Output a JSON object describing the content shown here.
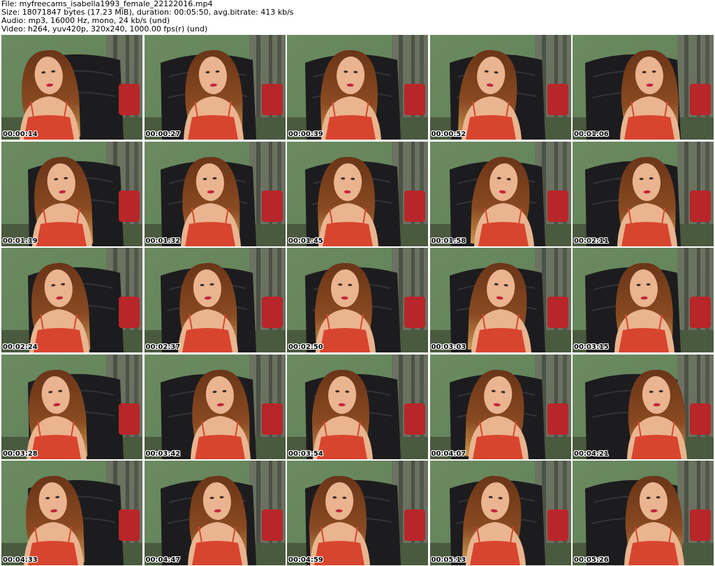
{
  "header": {
    "file_line": "File: myfreecams_isabella1993_female_22122016.mp4",
    "size_line": "Size: 18071847 bytes (17.23 MiB), duration: 00:05:50, avg.bitrate: 413 kb/s",
    "audio_line": "Audio: mp3, 16000 Hz, mono, 24 kb/s (und)",
    "video_line": "Video: h264, yuv420p, 320x240, 1000.00 fps(r) (und)"
  },
  "thumbnails": [
    {
      "timestamp": "00:00:14"
    },
    {
      "timestamp": "00:00:27"
    },
    {
      "timestamp": "00:00:39"
    },
    {
      "timestamp": "00:00:52"
    },
    {
      "timestamp": "00:01:06"
    },
    {
      "timestamp": "00:01:19"
    },
    {
      "timestamp": "00:01:32"
    },
    {
      "timestamp": "00:01:45"
    },
    {
      "timestamp": "00:01:58"
    },
    {
      "timestamp": "00:02:11"
    },
    {
      "timestamp": "00:02:24"
    },
    {
      "timestamp": "00:02:37"
    },
    {
      "timestamp": "00:02:50"
    },
    {
      "timestamp": "00:03:03"
    },
    {
      "timestamp": "00:03:15"
    },
    {
      "timestamp": "00:03:28"
    },
    {
      "timestamp": "00:03:42"
    },
    {
      "timestamp": "00:03:54"
    },
    {
      "timestamp": "00:04:07"
    },
    {
      "timestamp": "00:04:21"
    },
    {
      "timestamp": "00:04:33"
    },
    {
      "timestamp": "00:04:47"
    },
    {
      "timestamp": "00:04:59"
    },
    {
      "timestamp": "00:05:13"
    },
    {
      "timestamp": "00:05:26"
    }
  ],
  "colors": {
    "wall": "#5f7f56",
    "chair": "#1c1c1e",
    "curtain": "#6b6e62",
    "dress": "#d8452f",
    "skin": "#e9b48f",
    "hair": "#8a4a22",
    "cushion": "#b8262a",
    "timestamp_text": "#000000",
    "timestamp_outline": "#ffffff"
  }
}
